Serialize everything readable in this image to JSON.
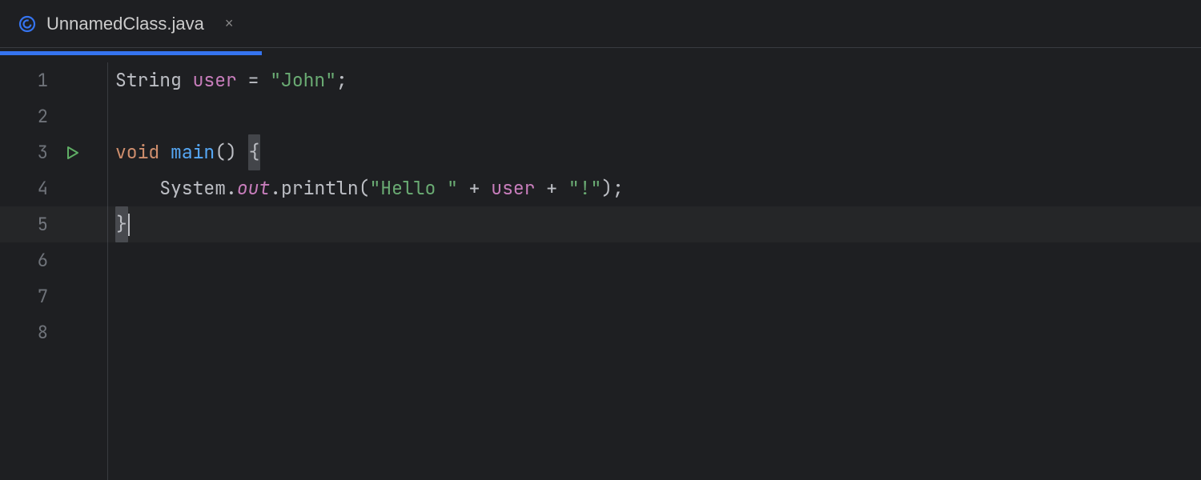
{
  "tab": {
    "filename": "UnnamedClass.java",
    "icon": "class-icon",
    "close": "×"
  },
  "gutter": {
    "line_numbers": [
      "1",
      "2",
      "3",
      "4",
      "5",
      "6",
      "7",
      "8"
    ],
    "run_at_line": 3
  },
  "code": {
    "lines": [
      {
        "segments": [
          {
            "t": "String ",
            "c": "tok-type"
          },
          {
            "t": "user",
            "c": "tok-var"
          },
          {
            "t": " = ",
            "c": "tok-op"
          },
          {
            "t": "\"John\"",
            "c": "tok-string"
          },
          {
            "t": ";",
            "c": "tok-semi"
          }
        ]
      },
      {
        "segments": []
      },
      {
        "segments": [
          {
            "t": "void ",
            "c": "tok-keyword"
          },
          {
            "t": "main",
            "c": "tok-ident"
          },
          {
            "t": "() ",
            "c": "tok-paren"
          },
          {
            "t": "{",
            "c": "tok-brace match-brace"
          }
        ]
      },
      {
        "segments": [
          {
            "t": "    ",
            "c": ""
          },
          {
            "t": "System",
            "c": "tok-class"
          },
          {
            "t": ".",
            "c": "tok-op"
          },
          {
            "t": "out",
            "c": "tok-static"
          },
          {
            "t": ".",
            "c": "tok-op"
          },
          {
            "t": "println",
            "c": "tok-method"
          },
          {
            "t": "(",
            "c": "tok-paren"
          },
          {
            "t": "\"Hello \"",
            "c": "tok-string"
          },
          {
            "t": " + ",
            "c": "tok-op"
          },
          {
            "t": "user",
            "c": "tok-var"
          },
          {
            "t": " + ",
            "c": "tok-op"
          },
          {
            "t": "\"!\"",
            "c": "tok-string"
          },
          {
            "t": ")",
            "c": "tok-paren"
          },
          {
            "t": ";",
            "c": "tok-semi"
          }
        ]
      },
      {
        "segments": [
          {
            "t": "}",
            "c": "tok-brace match-brace"
          },
          {
            "caret": true
          }
        ]
      },
      {
        "segments": []
      },
      {
        "segments": []
      },
      {
        "segments": []
      }
    ],
    "current_line_index": 4
  },
  "colors": {
    "accent": "#3574f0",
    "run_green": "#5fad65"
  }
}
